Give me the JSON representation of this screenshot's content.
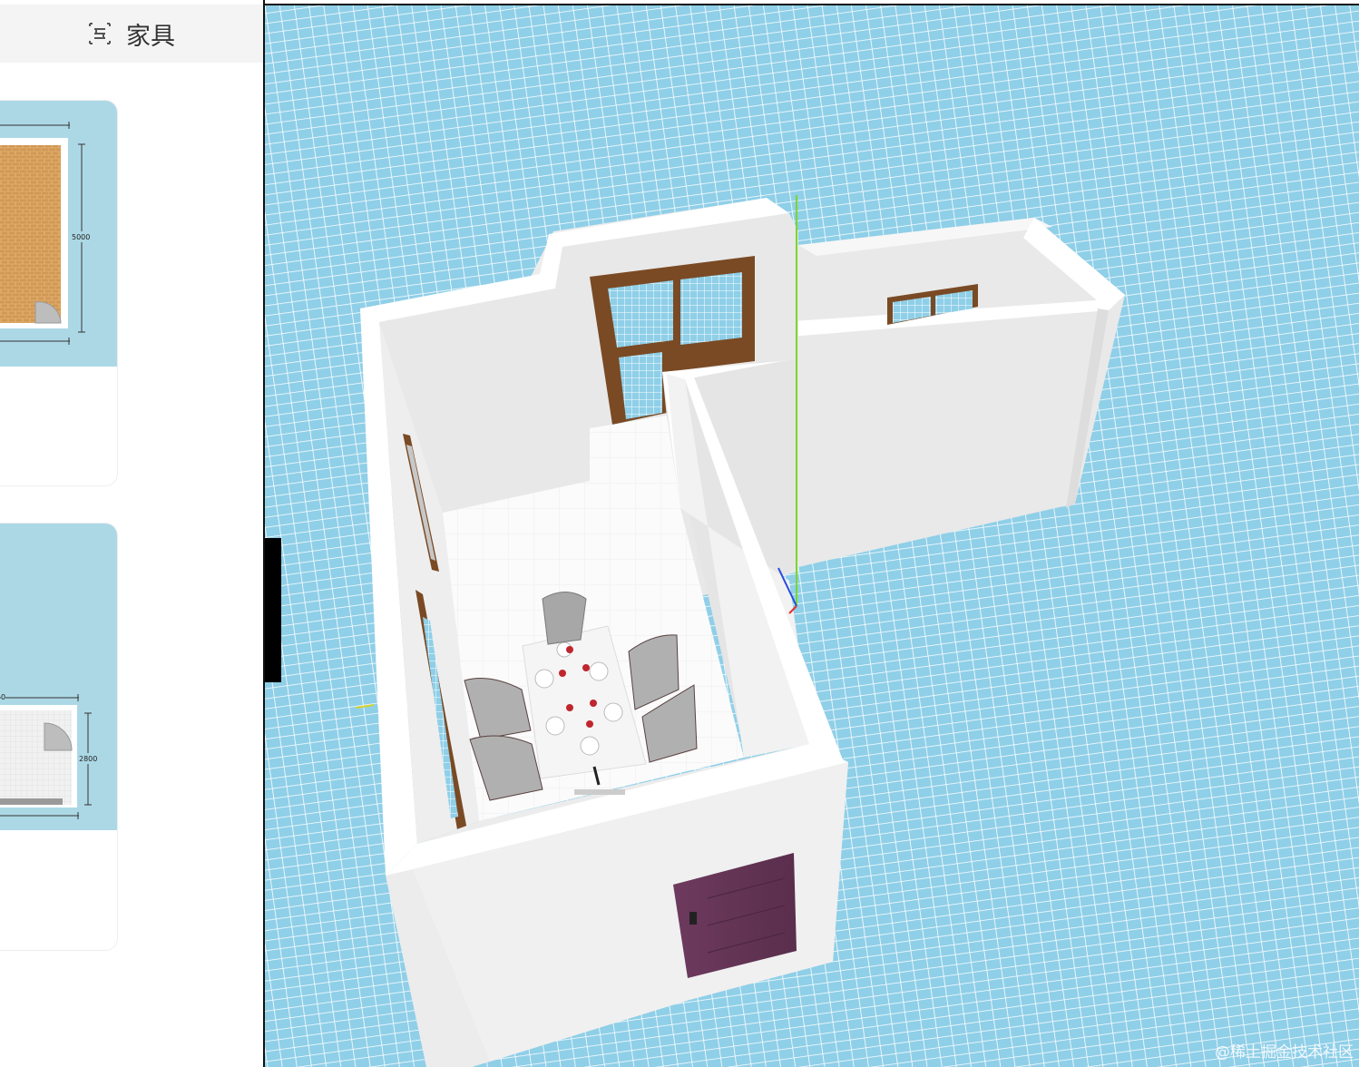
{
  "sidebar": {
    "tab": {
      "icon": "furniture-tab-icon",
      "label": "家具"
    },
    "templates": [
      {
        "dimension_label": "5000"
      },
      {
        "dimension_label": "2800",
        "partial_label": "0"
      }
    ]
  },
  "viewport": {
    "watermark": "@稀土掘金技术社区"
  },
  "colors": {
    "sidebar_header_bg": "#f4f4f4",
    "thumbnail_bg": "#acd8e6",
    "floor_tile_bg": "#8fcfe8",
    "wall": "#ececec",
    "window_frame": "#7a4a24",
    "door": "#6b3a5c"
  }
}
